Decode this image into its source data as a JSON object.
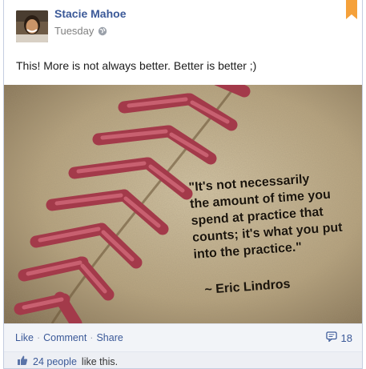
{
  "post": {
    "author": "Stacie Mahoe",
    "time": "Tuesday",
    "privacy_icon": "globe-icon",
    "message": "This! More is not always better. Better is better ;)"
  },
  "image": {
    "quote_lines": [
      "\"It's not necessarily",
      "the amount of time you",
      "spend at practice that",
      "counts; it's what you put",
      "into the practice.\""
    ],
    "quote_author": "~ Eric Lindros"
  },
  "actions": {
    "like": "Like",
    "comment": "Comment",
    "share": "Share",
    "separator": "·",
    "comment_count": "18",
    "comment_icon": "comment-bubble-icon"
  },
  "likes": {
    "icon": "thumbs-up-icon",
    "count_text": "24 people",
    "suffix": "like this."
  },
  "colors": {
    "link": "#3b5998",
    "bookmark": "#f5a13a",
    "action_bar": "#f2f4f8"
  }
}
